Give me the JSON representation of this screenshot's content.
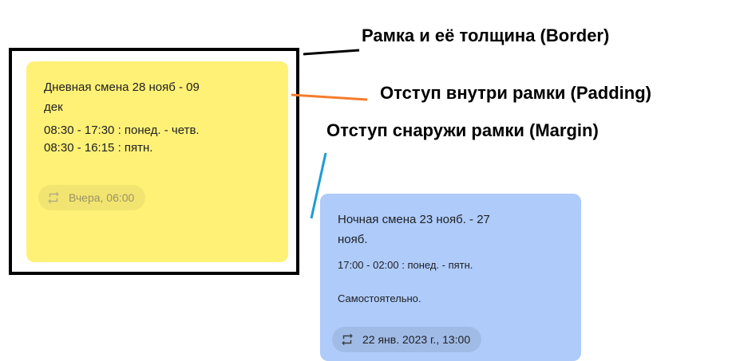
{
  "notes": [
    {
      "color": "#fff176",
      "title_lines": [
        "Дневная смена 28 нояб - 09",
        "дек"
      ],
      "body_lines": [
        "08:30 - 17:30 : понед. - четв.",
        "08:30 - 16:15 : пятн."
      ],
      "chip": {
        "icon": "repeat-icon",
        "label": "Вчера, 06:00"
      }
    },
    {
      "color": "#aecbfa",
      "title_lines": [
        "Ночная смена 23 нояб. - 27",
        "нояб."
      ],
      "body_lines": [
        "17:00 - 02:00 : понед. - пятн."
      ],
      "extra": "Самостоятельно.",
      "chip": {
        "icon": "repeat-icon",
        "label": "22 янв. 2023 г., 13:00"
      }
    }
  ],
  "annotations": {
    "border": {
      "label": "Рамка и её толщина (Border)",
      "color": "#000000"
    },
    "padding": {
      "label": "Отступ внутри рамки (Padding)",
      "color": "#f57c2b"
    },
    "margin": {
      "label": "Отступ снаружи рамки (Margin)",
      "color": "#1e9bd7"
    }
  }
}
